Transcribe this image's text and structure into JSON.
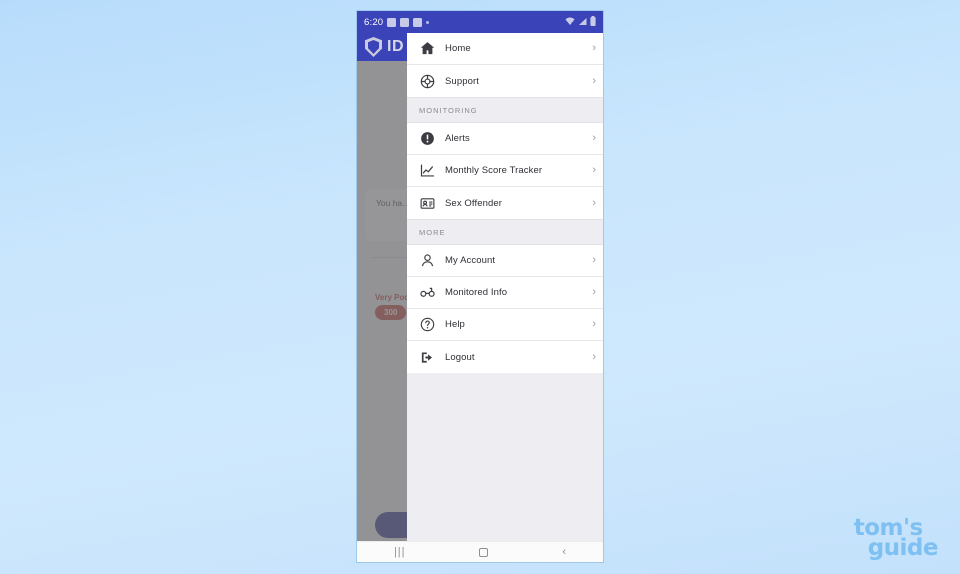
{
  "status_bar": {
    "clock": "6:20",
    "left_icons": [
      "save-icon",
      "mail-icon",
      "app-badge-icon",
      "dot-icon"
    ],
    "right_icons": [
      "wifi-icon",
      "signal-icon",
      "battery-icon"
    ],
    "background_color": "#3a43b8"
  },
  "app_background": {
    "header": {
      "logo_text": "ID",
      "logo_icon": "shield-icon"
    },
    "notice_text": "You ha… review…",
    "score_label": "Very Poor",
    "score_value": "300",
    "score_color": "#c0392b",
    "primary_button_color": "#1d2585",
    "secondary_button_color": "#0b5417"
  },
  "drawer": {
    "sections": [
      {
        "header": null,
        "items": [
          {
            "label": "Home",
            "icon": "home-icon",
            "chevron": "›"
          },
          {
            "label": "Support",
            "icon": "lifebuoy-icon",
            "chevron": "›"
          }
        ]
      },
      {
        "header": "MONITORING",
        "items": [
          {
            "label": "Alerts",
            "icon": "alert-circle-icon",
            "chevron": "›"
          },
          {
            "label": "Monthly Score Tracker",
            "icon": "chart-line-icon",
            "chevron": "›"
          },
          {
            "label": "Sex Offender",
            "icon": "id-card-icon",
            "chevron": "›"
          }
        ]
      },
      {
        "header": "MORE",
        "items": [
          {
            "label": "My Account",
            "icon": "person-icon",
            "chevron": "›"
          },
          {
            "label": "Monitored Info",
            "icon": "glasses-icon",
            "chevron": "›"
          },
          {
            "label": "Help",
            "icon": "question-circle-icon",
            "chevron": "›"
          },
          {
            "label": "Logout",
            "icon": "logout-icon",
            "chevron": "›"
          }
        ]
      }
    ]
  },
  "nav_bar": {
    "recents": "|||",
    "home": "home-square-icon",
    "back": "‹"
  },
  "watermark": {
    "line1": "tom's",
    "line2": "guide",
    "color": "#7ec0f2"
  }
}
